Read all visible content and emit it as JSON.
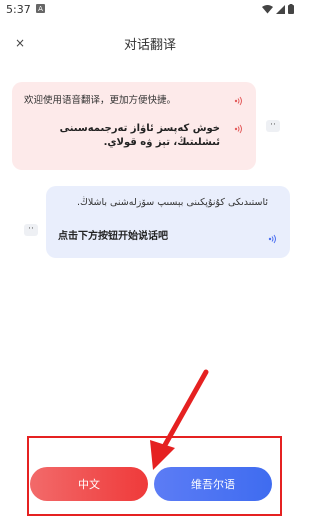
{
  "status_bar": {
    "time": "5:37",
    "left_icon": "a-notification-icon",
    "right_icons": [
      "wifi-icon",
      "signal-icon",
      "battery-icon"
    ]
  },
  "header": {
    "close_label": "×",
    "title": "对话翻译"
  },
  "conversation": {
    "pink_message": {
      "chinese": "欢迎使用语音翻译，更加方便快捷。",
      "uyghur": "خوش كەپسز ئاۋاز تەرجىمەسىنى ئىشلىتىڭ، تېز ۋە قولاي."
    },
    "blue_message": {
      "uyghur": "ئاستىدىكى كۇنۇپكىنى بېسىپ سۆزلەشنى باشلاڭ.",
      "chinese": "点击下方按钮开始说话吧"
    },
    "side_badges": [
      "··",
      "··"
    ]
  },
  "buttons": {
    "chinese_label": "中文",
    "uyghur_label": "维吾尔语"
  },
  "colors": {
    "pink_bubble": "#fdeaea",
    "blue_bubble": "#e9eefc",
    "chinese_button": "#ef3a3a",
    "uyghur_button": "#3f6cf0",
    "annotation_red": "#e52121"
  }
}
